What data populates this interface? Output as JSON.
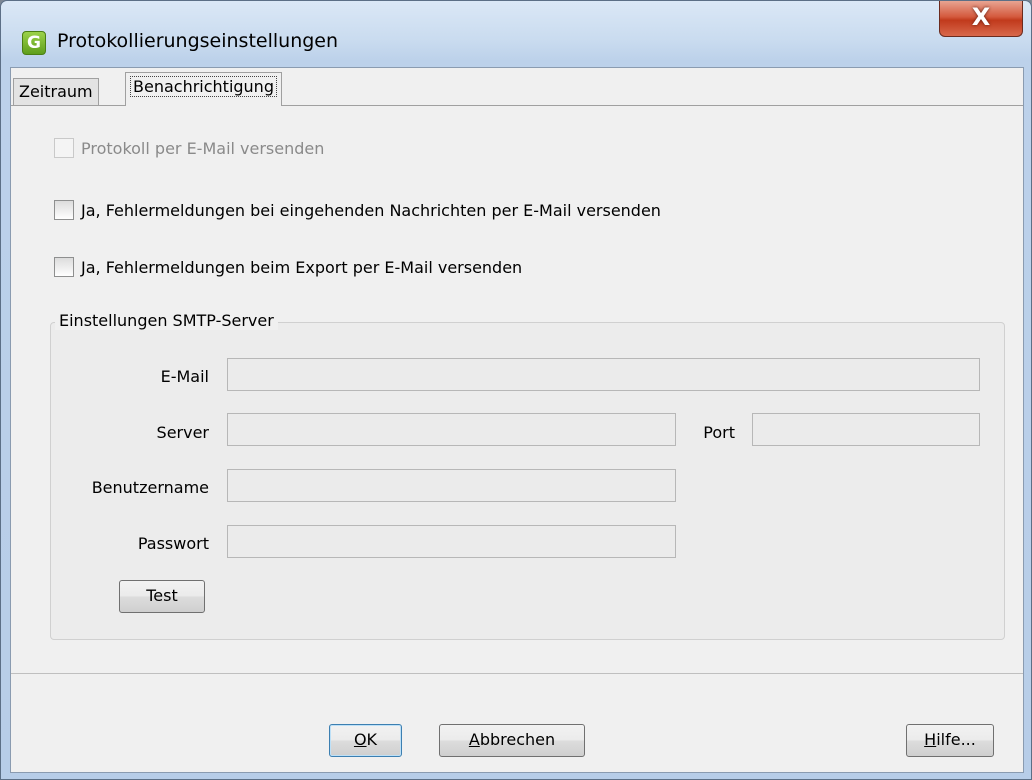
{
  "window": {
    "title": "Protokollierungseinstellungen",
    "app_icon_letter": "G",
    "close_label": "X"
  },
  "tabs": [
    {
      "label": "Zeitraum",
      "active": false
    },
    {
      "label": "Benachrichtigung",
      "active": true
    }
  ],
  "options": [
    {
      "label": "Protokoll per E-Mail versenden",
      "checked": false,
      "enabled": false
    },
    {
      "label": "Ja, Fehlermeldungen bei eingehenden Nachrichten per E-Mail versenden",
      "checked": false,
      "enabled": true
    },
    {
      "label": "Ja, Fehlermeldungen beim Export per E-Mail versenden",
      "checked": false,
      "enabled": true
    }
  ],
  "smtp": {
    "group_title": "Einstellungen SMTP-Server",
    "email_label": "E-Mail",
    "email_value": "",
    "server_label": "Server",
    "server_value": "",
    "port_label": "Port",
    "port_value": "",
    "username_label": "Benutzername",
    "username_value": "",
    "password_label": "Passwort",
    "password_value": "",
    "test_label": "Test"
  },
  "buttons": {
    "ok_mnemonic": "O",
    "ok_rest": "K",
    "cancel_mnemonic": "A",
    "cancel_rest": "bbrechen",
    "help_mnemonic": "H",
    "help_rest": "ilfe..."
  }
}
